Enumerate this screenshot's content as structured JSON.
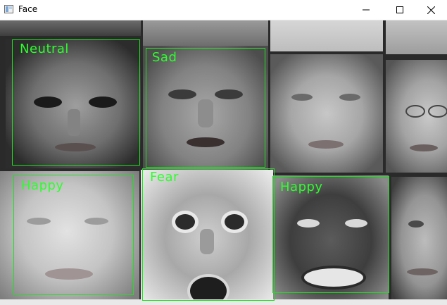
{
  "window": {
    "title": "Face",
    "controls": {
      "minimize_icon": "minimize-icon",
      "maximize_icon": "maximize-icon",
      "close_icon": "close-icon"
    }
  },
  "detections": [
    {
      "label": "Neutral"
    },
    {
      "label": "Sad"
    },
    {
      "label": "Happy"
    },
    {
      "label": "Fear"
    },
    {
      "label": "Happy"
    }
  ],
  "colors": {
    "box": "#1fe01f",
    "label": "#2cff2c"
  }
}
